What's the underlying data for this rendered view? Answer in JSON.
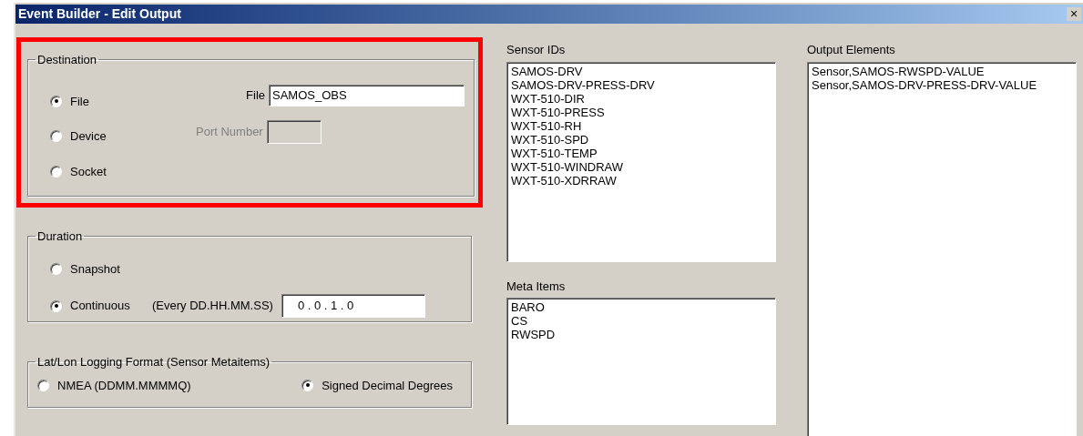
{
  "window": {
    "title": "Event Builder - Edit Output",
    "close": "×"
  },
  "highlight": {
    "on": true
  },
  "destination": {
    "title": "Destination",
    "options": [
      {
        "label": "File",
        "selected": true
      },
      {
        "label": "Device",
        "selected": false
      },
      {
        "label": "Socket",
        "selected": false
      }
    ],
    "file": {
      "label": "File",
      "value": "SAMOS_OBS",
      "disabled": false
    },
    "port": {
      "label": "Port Number",
      "disabled": true
    }
  },
  "duration": {
    "title": "Duration",
    "options": [
      {
        "label": "Snapshot",
        "selected": false
      },
      {
        "label": "Continuous",
        "selected": true
      }
    ],
    "interval": {
      "label": "(Every DD.HH.MM.SS)",
      "value": "0 . 0 . 1 . 0"
    }
  },
  "latlon": {
    "title": "Lat/Lon Logging Format (Sensor Metaitems)",
    "options": [
      {
        "label": "NMEA (DDMM.MMMMQ)",
        "selected": false
      },
      {
        "label": "Signed Decimal Degrees",
        "selected": true
      }
    ]
  },
  "sensor_ids": {
    "title": "Sensor IDs",
    "items": [
      "SAMOS-DRV",
      "SAMOS-DRV-PRESS-DRV",
      "WXT-510-DIR",
      "WXT-510-PRESS",
      "WXT-510-RH",
      "WXT-510-SPD",
      "WXT-510-TEMP",
      "WXT-510-WINDRAW",
      "WXT-510-XDRRAW"
    ]
  },
  "meta_items": {
    "title": "Meta Items",
    "items": [
      "BARO",
      "CS",
      "RWSPD"
    ]
  },
  "output_elements": {
    "title": "Output Elements",
    "items": [
      "Sensor,SAMOS-RWSPD-VALUE",
      "Sensor,SAMOS-DRV-PRESS-DRV-VALUE"
    ]
  }
}
